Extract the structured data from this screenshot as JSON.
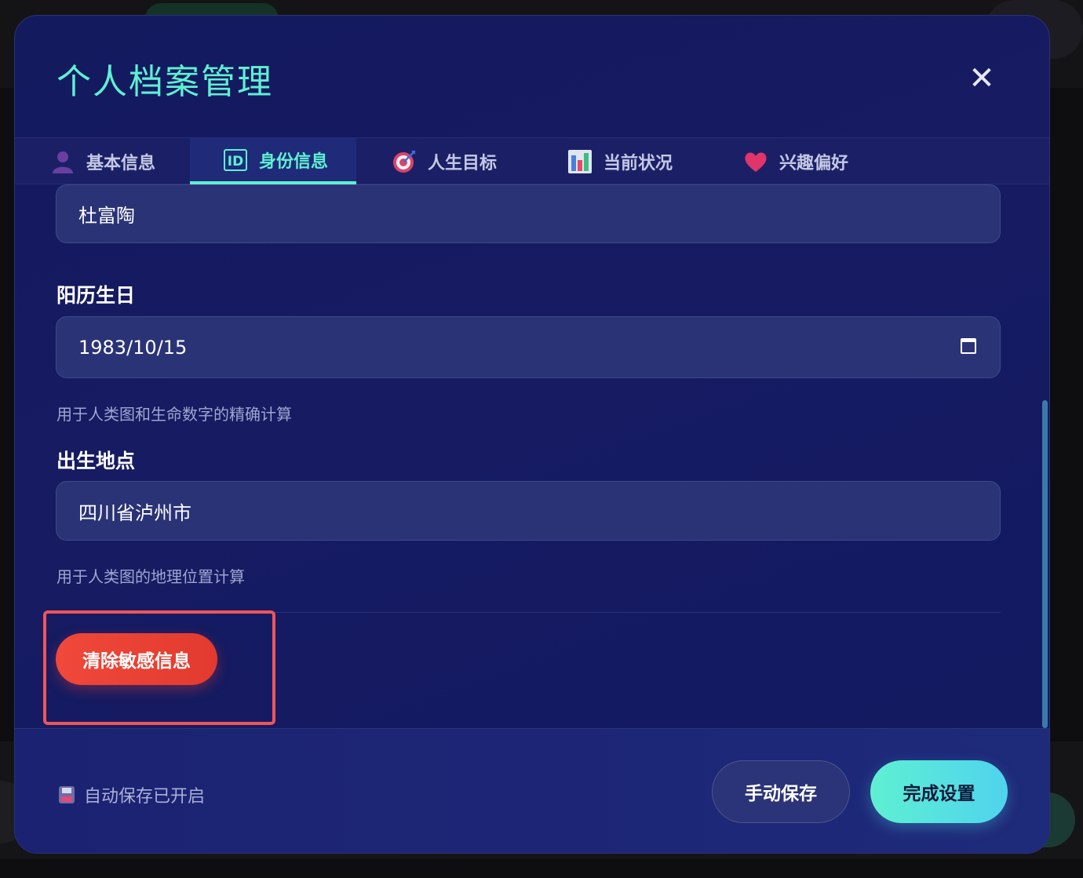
{
  "modal": {
    "title": "个人档案管理",
    "close_icon": "close-icon"
  },
  "tabs": [
    {
      "label": "基本信息",
      "icon": "person-icon"
    },
    {
      "label": "身份信息",
      "icon": "id-icon",
      "active": true
    },
    {
      "label": "人生目标",
      "icon": "target-icon"
    },
    {
      "label": "当前状况",
      "icon": "bar-chart-icon"
    },
    {
      "label": "兴趣偏好",
      "icon": "heart-icon"
    }
  ],
  "form": {
    "name_value": "杜富陶",
    "birthday_label": "阳历生日",
    "birthday_value": "1983/10/15",
    "birthday_hint": "用于人类图和生命数字的精确计算",
    "birthplace_label": "出生地点",
    "birthplace_value": "四川省泸州市",
    "birthplace_hint": "用于人类图的地理位置计算",
    "clear_button": "清除敏感信息"
  },
  "footer": {
    "autosave_status": "自动保存已开启",
    "manual_save": "手动保存",
    "finish": "完成设置"
  },
  "colors": {
    "accent": "#5ef0d2",
    "danger": "#f0483a",
    "modal_bg": "#141a5e"
  }
}
